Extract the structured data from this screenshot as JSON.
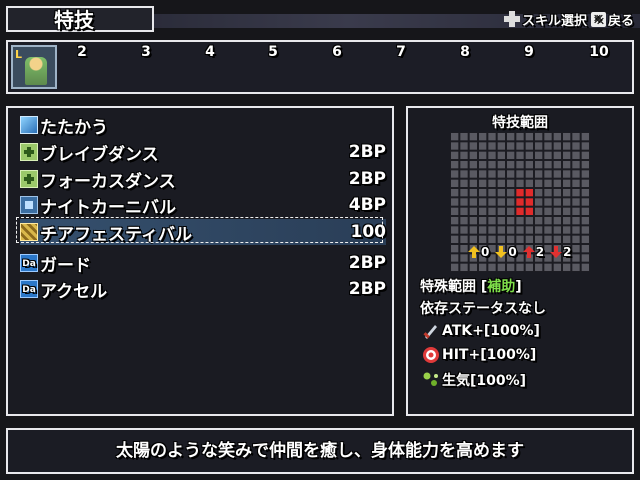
{
  "header": {
    "title": "特技",
    "controls": [
      {
        "icon": "dpad-icon",
        "label": "スキル選択"
      },
      {
        "icon": "x-button-icon",
        "label": "戻る"
      }
    ]
  },
  "party": {
    "portrait_badge": "L",
    "slots": [
      "2",
      "3",
      "4",
      "5",
      "6",
      "7",
      "8",
      "9",
      "10"
    ]
  },
  "skills": [
    {
      "icon": "sword-icon",
      "name": "たたかう",
      "bp": ""
    },
    {
      "icon": "support-plus-icon",
      "name": "ブレイブダンス",
      "bp": "2BP"
    },
    {
      "icon": "support-plus-icon",
      "name": "フォーカスダンス",
      "bp": "2BP"
    },
    {
      "icon": "square-icon",
      "name": "ナイトカーニバル",
      "bp": "4BP"
    },
    {
      "icon": "cheer-icon",
      "name": "チアフェスティバル",
      "bp": "100",
      "selected": true
    },
    {
      "icon": "da-icon",
      "icon_text": "Da",
      "name": "ガード",
      "bp": "2BP"
    },
    {
      "icon": "da-icon",
      "icon_text": "Da",
      "name": "アクセル",
      "bp": "2BP"
    }
  ],
  "range_panel": {
    "heading": "特技範囲",
    "grid": {
      "cols": 15,
      "rows": 15,
      "highlight": [
        [
          7,
          6
        ],
        [
          8,
          6
        ],
        [
          7,
          7
        ],
        [
          8,
          7
        ],
        [
          7,
          8
        ],
        [
          8,
          8
        ]
      ],
      "highlight_color": "#e02b2b"
    },
    "modifiers": [
      {
        "icon": "up-arrow-icon",
        "value": "0",
        "color": "#f0c020"
      },
      {
        "icon": "down-arrow-icon",
        "value": "0",
        "color": "#f0c020"
      },
      {
        "icon": "up-arrow-icon",
        "value": "2",
        "color": "#e03030"
      },
      {
        "icon": "down-arrow-icon",
        "value": "2",
        "color": "#e03030"
      }
    ],
    "special_label": "特殊範囲 [",
    "special_value": "補助",
    "special_close": "]",
    "dependency": "依存ステータスなし",
    "stats": [
      {
        "icon": "sword-stat-icon",
        "text": "ATK+[100%]"
      },
      {
        "icon": "target-stat-icon",
        "text": "HIT+[100%]"
      },
      {
        "icon": "leaf-stat-icon",
        "text": "生気[100%]"
      }
    ]
  },
  "description": "太陽のような笑みで仲間を癒し、身体能力を高めます"
}
